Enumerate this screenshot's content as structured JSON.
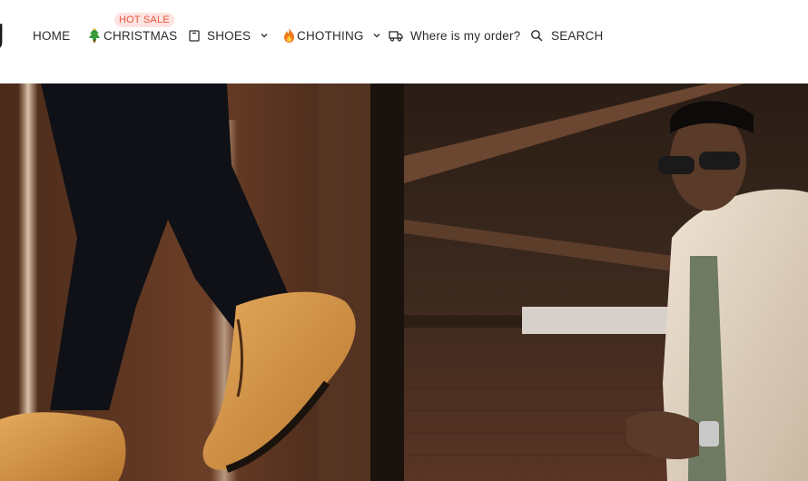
{
  "logo": {
    "mark": "J"
  },
  "nav": {
    "items": [
      {
        "label": "HOME",
        "icon": "none"
      },
      {
        "label": "CHRISTMAS",
        "icon": "christmas-tree-icon",
        "badge": "HOT SALE"
      },
      {
        "label": "SHOES",
        "icon": "shoe-box-icon",
        "has_dropdown": true
      },
      {
        "label": "CHOTHING",
        "icon": "fire-icon",
        "has_dropdown": true
      },
      {
        "label": "Where is my order?",
        "icon": "truck-icon"
      },
      {
        "label": "SEARCH",
        "icon": "search-icon"
      }
    ]
  },
  "hero": {
    "image": "man-wearing-tan-brogue-shoes-photo"
  },
  "colors": {
    "badge_bg": "#fde4e1",
    "badge_text": "#e8553d",
    "text": "#2b2b2b",
    "accent_shoe": "#d99a4e"
  }
}
